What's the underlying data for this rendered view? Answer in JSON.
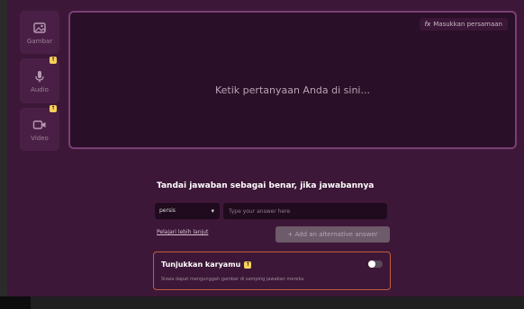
{
  "sidebar": {
    "items": [
      {
        "label": "Gambar",
        "icon": "image-icon",
        "badge": ""
      },
      {
        "label": "Audio",
        "icon": "microphone-icon",
        "badge": "↑"
      },
      {
        "label": "Video",
        "icon": "video-icon",
        "badge": "↑"
      }
    ]
  },
  "editor": {
    "placeholder": "Ketik pertanyaan Anda di sini...",
    "equation_button": {
      "icon_text": "fx",
      "label": "Masukkan persamaan"
    }
  },
  "answer_section": {
    "heading": "Tandai jawaban sebagai benar, jika jawabannya",
    "match_type": "persis",
    "answer_placeholder": "Type your answer here",
    "learn_more": "Pelajari lebih lanjut",
    "add_alt_button": "+ Add an alternative answer"
  },
  "work_card": {
    "title": "Tunjukkan karyamu",
    "badge": "↑",
    "description": "Siswa dapat mengunggah gambar di samping jawaban mereka",
    "toggle_on": false
  },
  "colors": {
    "background": "#3d1738",
    "editor_bg": "#2a0f28",
    "editor_border": "#7a3f74",
    "badge": "#f7d25a",
    "card_border": "#c0603a"
  }
}
